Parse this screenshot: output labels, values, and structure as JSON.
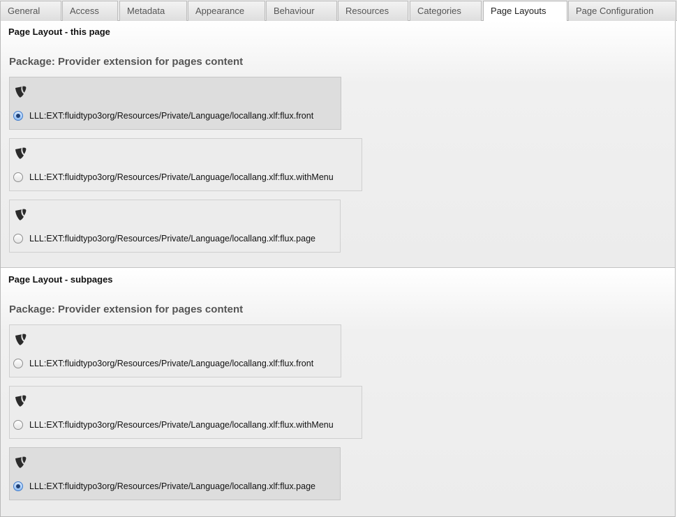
{
  "tabs": [
    {
      "label": "General",
      "active": false
    },
    {
      "label": "Access",
      "active": false
    },
    {
      "label": "Metadata",
      "active": false
    },
    {
      "label": "Appearance",
      "active": false
    },
    {
      "label": "Behaviour",
      "active": false
    },
    {
      "label": "Resources",
      "active": false
    },
    {
      "label": "Categories",
      "active": false
    },
    {
      "label": "Page Layouts",
      "active": true
    },
    {
      "label": "Page Configuration",
      "active": false
    }
  ],
  "sections": [
    {
      "title": "Page Layout - this page",
      "package": "Package: Provider extension for pages content",
      "options": [
        {
          "label": "LLL:EXT:fluidtypo3org/Resources/Private/Language/locallang.xlf:flux.front",
          "icon": "typo3-logo-icon",
          "selected": true
        },
        {
          "label": "LLL:EXT:fluidtypo3org/Resources/Private/Language/locallang.xlf:flux.withMenu",
          "icon": "typo3-logo-icon",
          "selected": false
        },
        {
          "label": "LLL:EXT:fluidtypo3org/Resources/Private/Language/locallang.xlf:flux.page",
          "icon": "typo3-logo-icon",
          "selected": false
        }
      ]
    },
    {
      "title": "Page Layout - subpages",
      "package": "Package: Provider extension for pages content",
      "options": [
        {
          "label": "LLL:EXT:fluidtypo3org/Resources/Private/Language/locallang.xlf:flux.front",
          "icon": "typo3-logo-icon",
          "selected": false
        },
        {
          "label": "LLL:EXT:fluidtypo3org/Resources/Private/Language/locallang.xlf:flux.withMenu",
          "icon": "typo3-logo-icon",
          "selected": false
        },
        {
          "label": "LLL:EXT:fluidtypo3org/Resources/Private/Language/locallang.xlf:flux.page",
          "icon": "typo3-logo-icon",
          "selected": true
        }
      ]
    }
  ]
}
